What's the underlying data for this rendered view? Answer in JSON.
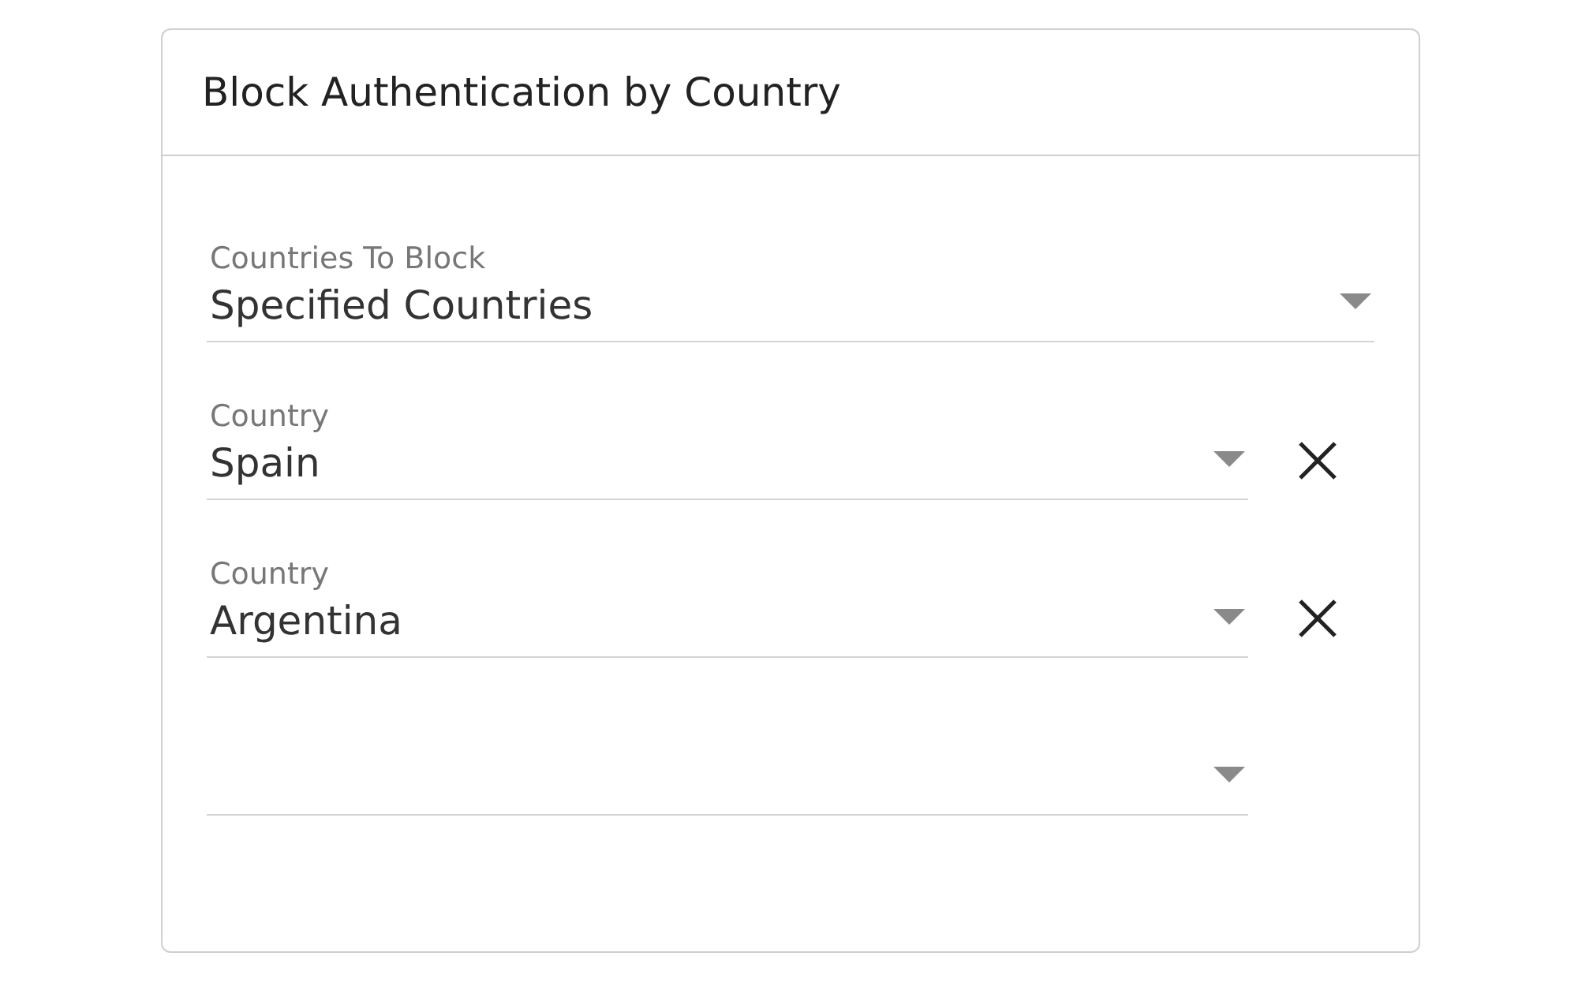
{
  "card": {
    "title": "Block Authentication by Country"
  },
  "fields": [
    {
      "label": "Countries To Block",
      "value": "Specified Countries",
      "removable": false
    },
    {
      "label": "Country",
      "value": "Spain",
      "removable": true
    },
    {
      "label": "Country",
      "value": "Argentina",
      "removable": true
    },
    {
      "removable": false
    }
  ]
}
